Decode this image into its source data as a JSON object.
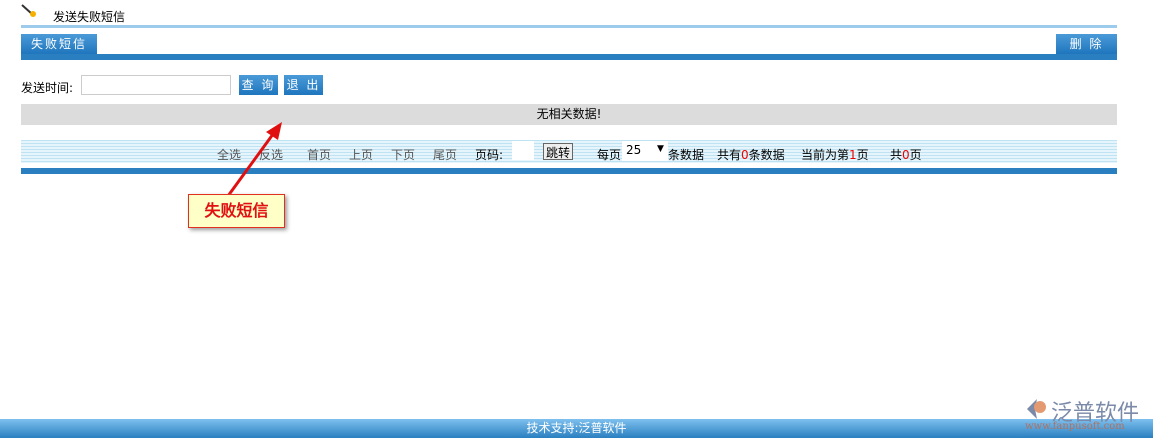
{
  "header": {
    "title": "发送失败短信",
    "icon": "pen-icon"
  },
  "toolbar": {
    "tab_label": "失败短信",
    "delete_label": "删 除"
  },
  "search": {
    "label": "发送时间:",
    "value": "",
    "query_label": "查 询",
    "exit_label": "退 出"
  },
  "result": {
    "message": "无相关数据!"
  },
  "pager": {
    "select_all": "全选",
    "invert": "反选",
    "first": "首页",
    "prev": "上页",
    "next": "下页",
    "last": "尾页",
    "page_label": "页码:",
    "page_value": "",
    "jump": "跳转",
    "per_page_label": "每页",
    "per_page_value": "25",
    "per_page_suffix": "条数据",
    "total_prefix": "共有",
    "total_count": "0",
    "total_suffix": "条数据",
    "current_prefix": "当前为第",
    "current_page": "1",
    "current_suffix": "页",
    "pages_prefix": "共",
    "pages_count": "0",
    "pages_suffix": "页"
  },
  "annotation": {
    "text": "失败短信"
  },
  "footer": {
    "text": "技术支持:泛普软件",
    "logo_text": "泛普软件",
    "logo_url": "www.fanpusoft.com"
  }
}
